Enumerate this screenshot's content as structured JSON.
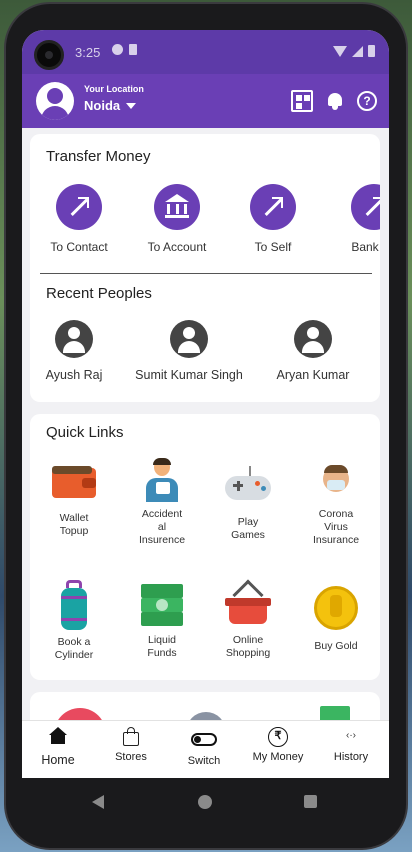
{
  "status_bar": {
    "time": "3:25"
  },
  "header": {
    "location_label": "Your Location",
    "location_value": "Noida"
  },
  "transfer": {
    "title": "Transfer Money",
    "items": [
      {
        "label": "To Contact",
        "icon": "arrow-icon"
      },
      {
        "label": "To Account",
        "icon": "bank-icon"
      },
      {
        "label": "To Self",
        "icon": "arrow-icon"
      },
      {
        "label": "Bank Ba",
        "icon": "arrow-icon"
      }
    ]
  },
  "recent": {
    "title": "Recent Peoples",
    "people": [
      {
        "name": "Ayush Raj"
      },
      {
        "name": "Sumit Kumar Singh"
      },
      {
        "name": "Aryan Kumar"
      }
    ]
  },
  "quick_links": {
    "title": "Quick Links",
    "items": [
      {
        "label": "Wallet\nTopup",
        "icon": "wallet-icon"
      },
      {
        "label": "Accident\nal\nInsurence",
        "icon": "injured-person-icon"
      },
      {
        "label": "Play\nGames",
        "icon": "gamepad-icon"
      },
      {
        "label": "Corona\nVirus\nInsurance",
        "icon": "masked-face-icon"
      },
      {
        "label": "Book a\nCylinder",
        "icon": "gas-cylinder-icon"
      },
      {
        "label": "Liquid\nFunds",
        "icon": "cash-icon"
      },
      {
        "label": "Online\nShopping",
        "icon": "shopping-basket-icon"
      },
      {
        "label": "Buy Gold",
        "icon": "gold-coin-icon"
      }
    ]
  },
  "bottom_nav": {
    "items": [
      {
        "label": "Home",
        "icon": "home-icon",
        "active": true
      },
      {
        "label": "Stores",
        "icon": "bag-icon"
      },
      {
        "label": "Switch",
        "icon": "toggle-icon"
      },
      {
        "label": "My Money",
        "icon": "rupee-icon"
      },
      {
        "label": "History",
        "icon": "history-icon"
      }
    ]
  },
  "colors": {
    "primary": "#6a3fb5",
    "statusbar": "#5d3aa8",
    "background": "#f1f1f4"
  }
}
